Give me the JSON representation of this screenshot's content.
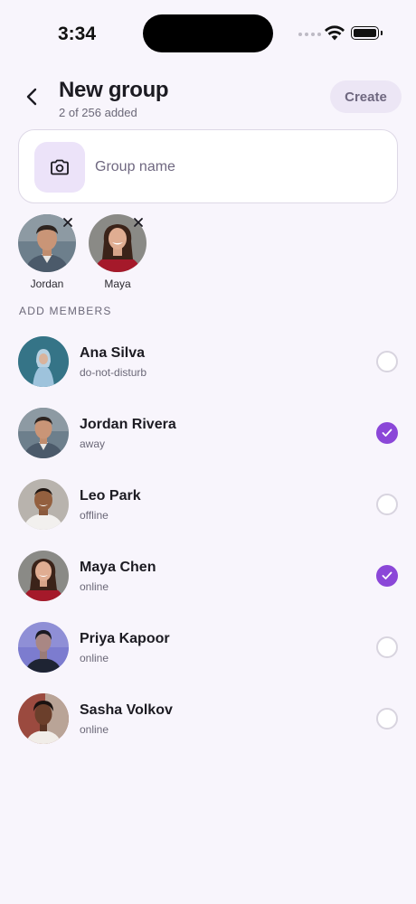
{
  "status_bar": {
    "time": "3:34"
  },
  "header": {
    "title": "New group",
    "subtitle": "2 of 256 added",
    "create_label": "Create"
  },
  "group": {
    "name_placeholder": "Group name",
    "name_value": ""
  },
  "selected": [
    {
      "name": "Jordan"
    },
    {
      "name": "Maya"
    }
  ],
  "section_label": "ADD MEMBERS",
  "contacts": [
    {
      "name": "Ana Silva",
      "status": "do-not-disturb",
      "selected": false
    },
    {
      "name": "Jordan Rivera",
      "status": "away",
      "selected": true
    },
    {
      "name": "Leo Park",
      "status": "offline",
      "selected": false
    },
    {
      "name": "Maya Chen",
      "status": "online",
      "selected": true
    },
    {
      "name": "Priya Kapoor",
      "status": "online",
      "selected": false
    },
    {
      "name": "Sasha Volkov",
      "status": "online",
      "selected": false
    }
  ],
  "colors": {
    "accent": "#8b47d8",
    "background": "#f8f5fc",
    "create_button_bg": "#ece6f5",
    "camera_tile_bg": "#ece3f9"
  },
  "icons": {
    "back": "chevron-left-icon",
    "camera": "camera-icon",
    "remove": "close-icon",
    "check": "checkmark-icon"
  }
}
